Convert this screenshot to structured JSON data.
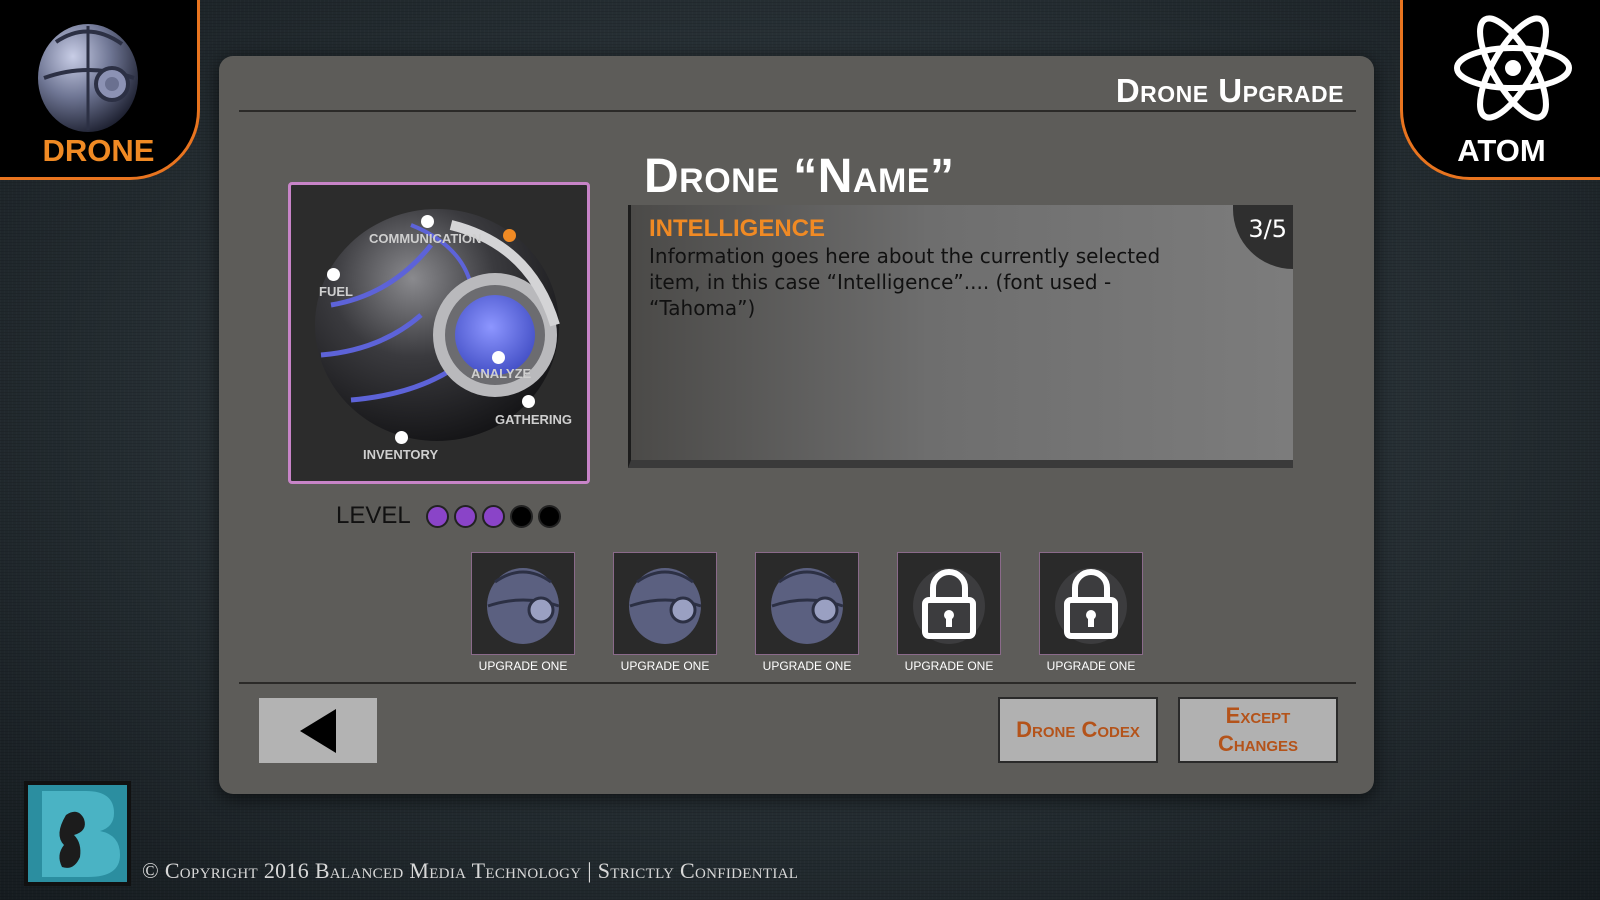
{
  "corners": {
    "left_label": "DRONE",
    "right_label": "ATOM"
  },
  "panel": {
    "title": "Drone Upgrade"
  },
  "drone_viewer": {
    "hotspots": [
      "COMMUNICATION",
      "FUEL",
      "ANALYZE",
      "GATHERING",
      "INVENTORY"
    ],
    "active_hotspot": "COMMUNICATION"
  },
  "level": {
    "label": "LEVEL",
    "current": 3,
    "max": 5
  },
  "detail": {
    "name": "Drone “Name”",
    "heading": "INTELLIGENCE",
    "text": "Information goes here about the currently selected item, in this case “Intelligence”.... (font used - “Tahoma”)",
    "counter": "3/5"
  },
  "upgrades": [
    {
      "label": "UPGRADE ONE",
      "locked": false
    },
    {
      "label": "UPGRADE ONE",
      "locked": false
    },
    {
      "label": "UPGRADE ONE",
      "locked": false
    },
    {
      "label": "UPGRADE ONE",
      "locked": true
    },
    {
      "label": "UPGRADE ONE",
      "locked": true
    }
  ],
  "buttons": {
    "codex": "Drone Codex",
    "except": "Except Changes"
  },
  "footer": {
    "copyright": "© Copyright 2016 Balanced Media Technology | Strictly Confidential"
  },
  "colors": {
    "accent_orange": "#f08a24",
    "level_purple": "#8a44c8",
    "button_text": "#b4531a",
    "panel": "#5d5c59"
  },
  "icons": [
    "drone-sphere-icon",
    "atom-icon",
    "lock-icon",
    "back-arrow-icon",
    "bmt-logo"
  ]
}
